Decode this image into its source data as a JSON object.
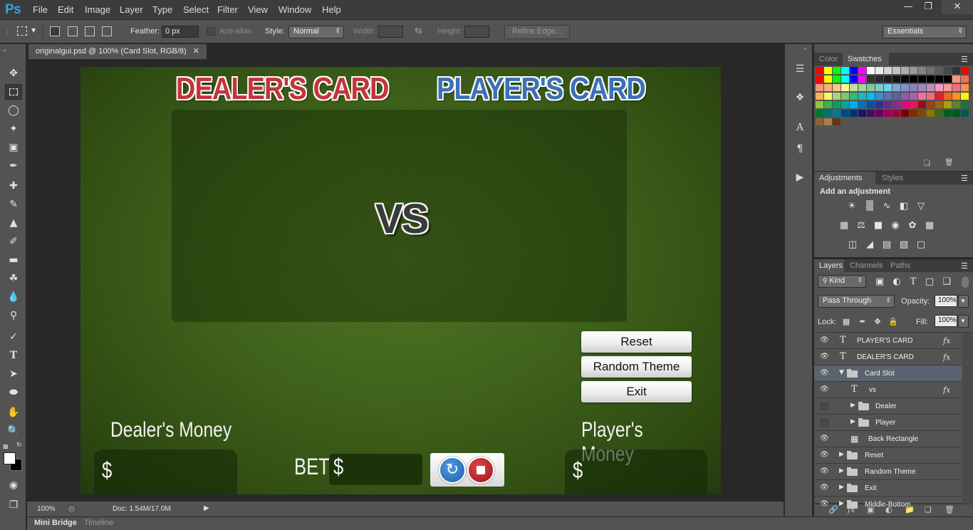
{
  "app": {
    "logo": "Ps",
    "menu": [
      "File",
      "Edit",
      "Image",
      "Layer",
      "Type",
      "Select",
      "Filter",
      "View",
      "Window",
      "Help"
    ],
    "window_buttons": [
      "minimize",
      "restore",
      "close"
    ]
  },
  "options_bar": {
    "feather_label": "Feather:",
    "feather_value": "0 px",
    "antialias_label": "Anti-alias",
    "style_label": "Style:",
    "style_value": "Normal",
    "width_label": "Width:",
    "height_label": "Height:",
    "refine_edge": "Refine Edge...",
    "workspace": "Essentials"
  },
  "document": {
    "tab_title": "originalgui.psd @ 100% (Card Slot, RGB/8)",
    "zoom": "100%",
    "doc_size": "Doc: 1.54M/17.0M"
  },
  "canvas": {
    "dealer_title": "DEALER'S CARD",
    "player_title": "PLAYER'S CARD",
    "vs": "VS",
    "buttons": {
      "reset": "Reset",
      "random_theme": "Random Theme",
      "exit": "Exit"
    },
    "dealer_money_label": "Dealer's Money",
    "player_money_label": "Player's Money",
    "currency": "$",
    "bet_label": "BET:"
  },
  "bottom_tabs": [
    "Mini Bridge",
    "Timeline"
  ],
  "panels": {
    "color_tabs": [
      "Color",
      "Swatches"
    ],
    "adjust_tabs": [
      "Adjustments",
      "Styles"
    ],
    "add_adjustment": "Add an adjustment",
    "layers_tabs": [
      "Layers",
      "Channels",
      "Paths"
    ],
    "filter_kind": "Kind",
    "blend_mode": "Pass Through",
    "opacity_label": "Opacity:",
    "opacity_value": "100%",
    "lock_label": "Lock:",
    "fill_label": "Fill:",
    "fill_value": "100%"
  },
  "layers": [
    {
      "name": "PLAYER'S CARD",
      "kind": "text",
      "visible": true,
      "fx": true,
      "indent": 0
    },
    {
      "name": "DEALER'S CARD",
      "kind": "text",
      "visible": true,
      "fx": true,
      "indent": 0
    },
    {
      "name": "Card Slot",
      "kind": "group-open",
      "visible": true,
      "fx": false,
      "indent": 0,
      "selected": true
    },
    {
      "name": "vs",
      "kind": "text",
      "visible": true,
      "fx": true,
      "indent": 1
    },
    {
      "name": "Dealer",
      "kind": "group",
      "visible": false,
      "fx": false,
      "indent": 1
    },
    {
      "name": "Player",
      "kind": "group",
      "visible": false,
      "fx": false,
      "indent": 1
    },
    {
      "name": "Back Rectangle",
      "kind": "shape",
      "visible": true,
      "fx": false,
      "indent": 1
    },
    {
      "name": "Reset",
      "kind": "group",
      "visible": true,
      "fx": false,
      "indent": 0
    },
    {
      "name": "Random Theme",
      "kind": "group",
      "visible": true,
      "fx": false,
      "indent": 0
    },
    {
      "name": "Exit",
      "kind": "group",
      "visible": true,
      "fx": false,
      "indent": 0
    },
    {
      "name": "Middle-Bottom",
      "kind": "group",
      "visible": true,
      "fx": false,
      "indent": 0
    }
  ],
  "colors": {
    "accent": "#2fa3e6",
    "dealer_red": "#c4353b",
    "player_blue": "#3c71b6",
    "felt_green": "#3e6219"
  }
}
